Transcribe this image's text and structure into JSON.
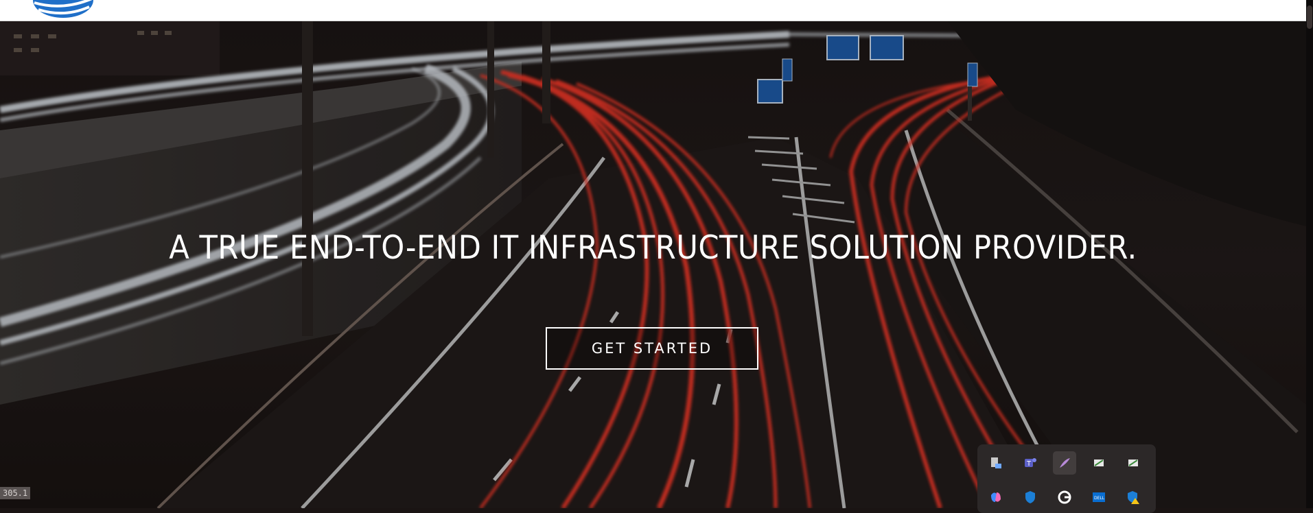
{
  "headline": "A TRUE END-TO-END IT INFRASTRUCTURE SOLUTION PROVIDER.",
  "cta_label": "GET STARTED",
  "coordinate_readout": "305.1",
  "colors": {
    "brand_blue": "#1f6fc8",
    "light_trail": "#ff3b2a",
    "white_trail": "#e8eef5",
    "overlay": "#000000"
  },
  "tray_icons": [
    {
      "name": "device-manager-icon"
    },
    {
      "name": "teams-icon"
    },
    {
      "name": "feather-pen-icon"
    },
    {
      "name": "snipping-tool-icon"
    },
    {
      "name": "snipping-tool-2-icon"
    },
    {
      "name": "copilot-icon"
    },
    {
      "name": "windows-security-icon"
    },
    {
      "name": "grammarly-icon"
    },
    {
      "name": "dell-icon"
    },
    {
      "name": "security-warning-icon"
    }
  ]
}
